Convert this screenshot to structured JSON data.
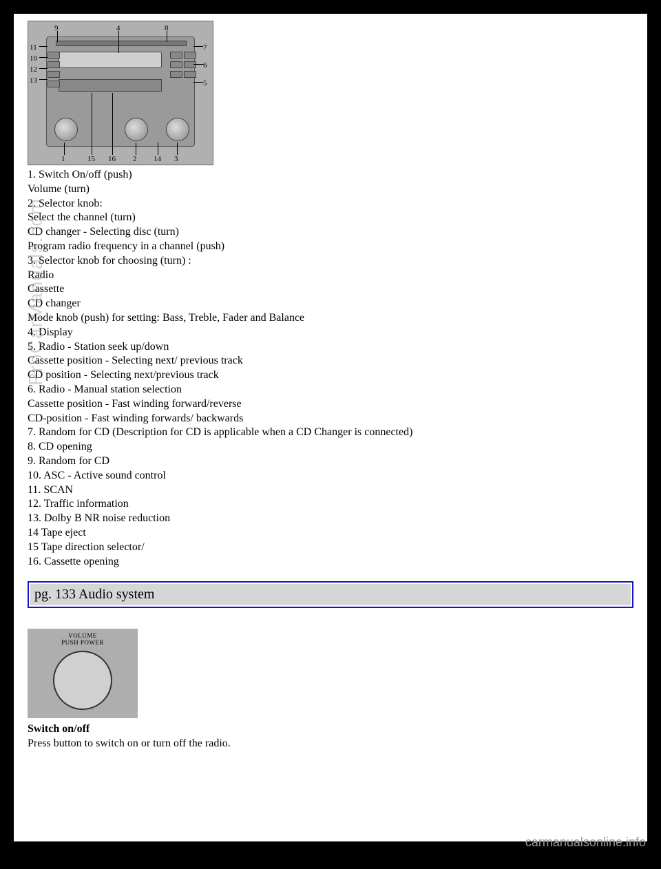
{
  "diagram": {
    "labels": {
      "1": "1",
      "2": "2",
      "3": "3",
      "4": "4",
      "5": "5",
      "6": "6",
      "7": "7",
      "8": "8",
      "9": "9",
      "10": "10",
      "11": "11",
      "12": "12",
      "13": "13",
      "14": "14",
      "15": "15",
      "16": "16"
    }
  },
  "controls_list": [
    "1. Switch On/off (push)",
    "Volume (turn)",
    "2. Selector knob:",
    "Select the channel (turn)",
    "CD changer - Selecting disc (turn)",
    "Program radio frequency in a channel (push)",
    "3. Selector knob for choosing (turn) :",
    "Radio",
    "Cassette",
    "CD changer",
    "Mode knob (push) for setting: Bass, Treble, Fader and Balance",
    "4. Display",
    "5. Radio - Station seek up/down",
    "Cassette position - Selecting next/ previous track",
    "CD position - Selecting next/previous track",
    "6. Radio - Manual station selection",
    "Cassette position - Fast winding forward/reverse",
    "CD-position - Fast winding forwards/ backwards",
    "7. Random for CD (Description for CD is applicable when a CD Changer is connected)",
    "8. CD opening",
    "9. Random for CD",
    "10. ASC - Active sound control",
    "11. SCAN",
    "12. Traffic information",
    "13. Dolby B NR noise reduction",
    "14 Tape eject",
    "15 Tape direction selector/",
    "16. Cassette opening"
  ],
  "section_header": "pg. 133 Audio system",
  "knob_figure": {
    "line1": "VOLUME",
    "line2": "PUSH POWER"
  },
  "switch_section": {
    "title": "Switch on/off",
    "text": "Press button to switch on or turn off the radio."
  },
  "watermark": "ProCarManuals.com",
  "footer": "carmanualsonline.info"
}
